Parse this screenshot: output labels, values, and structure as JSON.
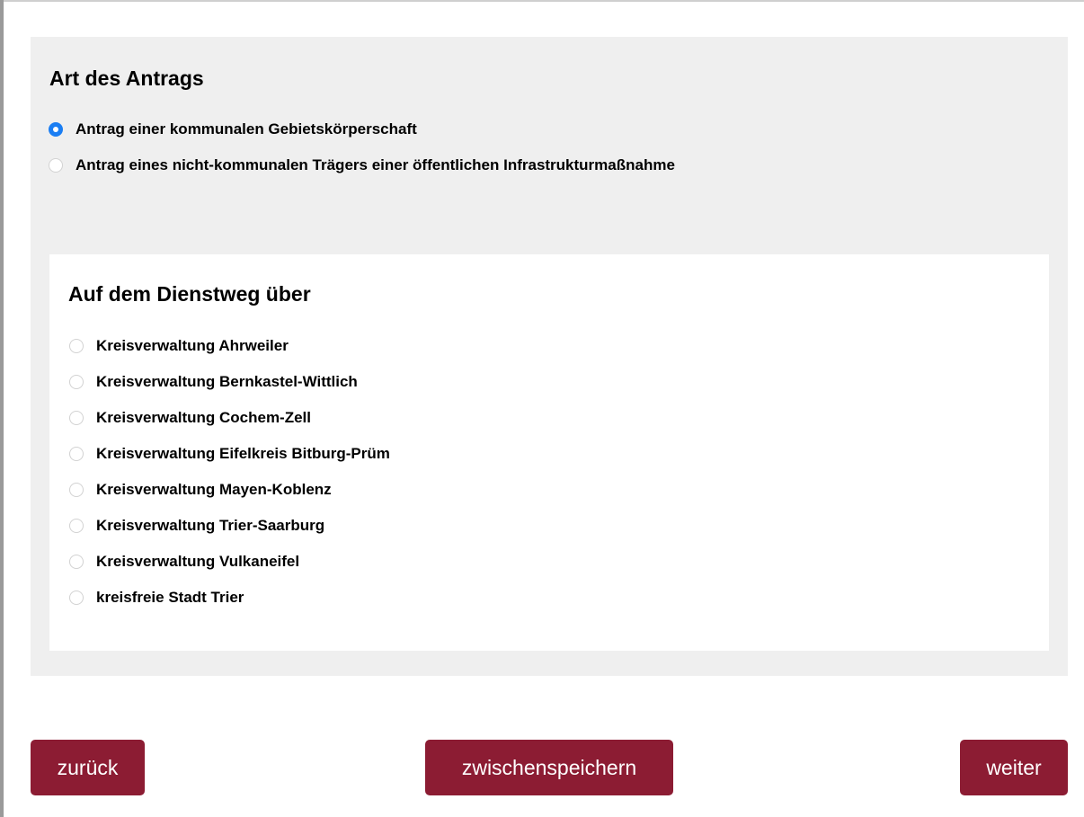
{
  "application_type": {
    "title": "Art des Antrags",
    "options": [
      {
        "label": "Antrag einer kommunalen Gebietskörperschaft",
        "selected": true
      },
      {
        "label": "Antrag eines nicht-kommunalen Trägers einer öffentlichen Infrastrukturmaßnahme",
        "selected": false
      }
    ]
  },
  "official_route": {
    "title": "Auf dem Dienstweg über",
    "options": [
      {
        "label": "Kreisverwaltung Ahrweiler",
        "selected": false
      },
      {
        "label": "Kreisverwaltung Bernkastel-Wittlich",
        "selected": false
      },
      {
        "label": "Kreisverwaltung Cochem-Zell",
        "selected": false
      },
      {
        "label": "Kreisverwaltung Eifelkreis Bitburg-Prüm",
        "selected": false
      },
      {
        "label": "Kreisverwaltung Mayen-Koblenz",
        "selected": false
      },
      {
        "label": "Kreisverwaltung Trier-Saarburg",
        "selected": false
      },
      {
        "label": "Kreisverwaltung Vulkaneifel",
        "selected": false
      },
      {
        "label": "kreisfreie Stadt Trier",
        "selected": false
      }
    ]
  },
  "buttons": {
    "back": "zurück",
    "save": "zwischenspeichern",
    "next": "weiter"
  },
  "colors": {
    "button_bg": "#8c1c33",
    "radio_selected": "#1b7ef3",
    "panel_bg": "#efefef"
  }
}
